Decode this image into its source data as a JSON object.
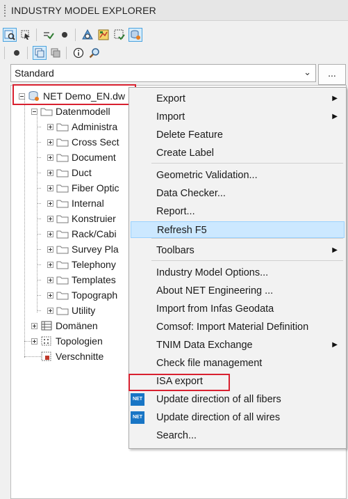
{
  "panel": {
    "title": "INDUSTRY MODEL EXPLORER"
  },
  "toolbar_row1": [
    "zoom-to-feature-icon",
    "select-icon",
    "validate-icon",
    "dot-icon",
    "filter-icon",
    "map-icon",
    "grid-check-icon",
    "database-settings-icon"
  ],
  "toolbar_row2": [
    "dot-icon",
    "copy-icon",
    "copy-gray-icon",
    "info-icon",
    "search-icon"
  ],
  "selector": {
    "value": "Standard",
    "button_label": "..."
  },
  "tree": {
    "root": "NET Demo_EN.dw",
    "data_model": "Datenmodell",
    "children": [
      "Administra",
      "Cross Sect",
      "Document",
      "Duct",
      "Fiber Optic",
      "Internal",
      "Konstruier",
      "Rack/Cabi",
      "Survey Pla",
      "Telephony",
      "Templates",
      "Topograph",
      "Utility"
    ],
    "domains": "Domänen",
    "topologies": "Topologien",
    "leftovers": "Verschnitte"
  },
  "context_menu": {
    "items": [
      {
        "label": "Export",
        "submenu": true
      },
      {
        "label": "Import",
        "submenu": true
      },
      {
        "label": "Delete Feature"
      },
      {
        "label": "Create Label"
      },
      {
        "label": "Geometric Validation..."
      },
      {
        "label": "Data Checker..."
      },
      {
        "label": "Report..."
      },
      {
        "label": "Refresh F5",
        "highlighted": true
      },
      {
        "label": "Toolbars",
        "submenu": true
      },
      {
        "label": "Industry Model Options..."
      },
      {
        "label": "About NET Engineering ..."
      },
      {
        "label": "Import from Infas Geodata"
      },
      {
        "label": "Comsof: Import Material Definition"
      },
      {
        "label": "TNIM Data Exchange",
        "submenu": true
      },
      {
        "label": "Check file management"
      },
      {
        "label": "ISA export",
        "annotated": true
      },
      {
        "label": "Update direction of all fibers",
        "icon": "NET"
      },
      {
        "label": "Update direction of all wires",
        "icon": "NET"
      },
      {
        "label": "Search..."
      }
    ]
  },
  "colors": {
    "highlight_annotation": "#d8202f",
    "menu_hover": "#cce8ff",
    "net_icon": "#1875c5"
  }
}
